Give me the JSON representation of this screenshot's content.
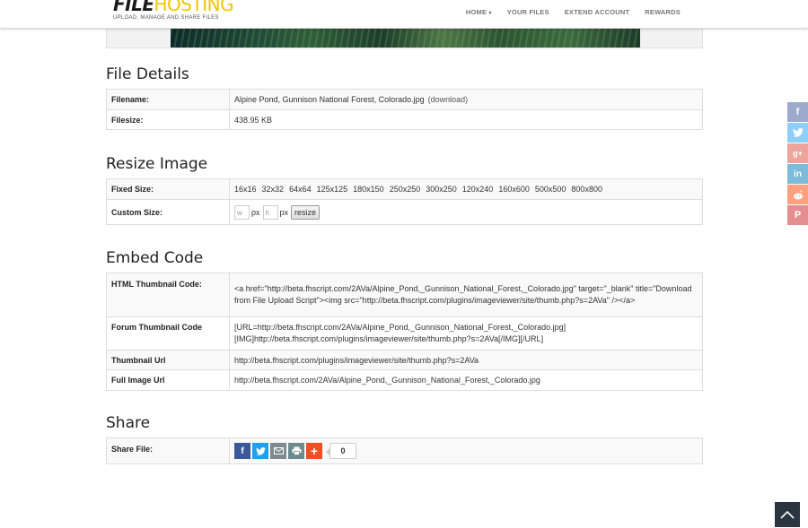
{
  "logo": {
    "file": "FILE",
    "hosting": "HOSTING",
    "tagline": "UPLOAD, MANAGE AND SHARE FILES"
  },
  "nav": {
    "home": "HOME",
    "your_files": "YOUR FILES",
    "extend": "EXTEND ACCOUNT",
    "rewards": "REWARDS"
  },
  "file_details": {
    "title": "File Details",
    "filename_label": "Filename:",
    "filename": "Alpine Pond, Gunnison National Forest, Colorado.jpg",
    "download": "(download)",
    "filesize_label": "Filesize:",
    "filesize": "438.95 KB"
  },
  "resize": {
    "title": "Resize Image",
    "fixed_label": "Fixed Size:",
    "sizes": [
      "16x16",
      "32x32",
      "64x64",
      "125x125",
      "180x150",
      "250x250",
      "300x250",
      "120x240",
      "160x600",
      "500x500",
      "800x800"
    ],
    "custom_label": "Custom Size:",
    "w_placeholder": "w",
    "h_placeholder": "h",
    "px": "px",
    "button": "resize"
  },
  "embed": {
    "title": "Embed Code",
    "rows": [
      {
        "label": "HTML Thumbnail Code:",
        "value": "<a href=\"http://beta.fhscript.com/2AVa/Alpine_Pond,_Gunnison_National_Forest,_Colorado.jpg\" target=\"_blank\" title=\"Download from File Upload Script\"><img src=\"http://beta.fhscript.com/plugins/imageviewer/site/thumb.php?s=2AVa\" /></a>"
      },
      {
        "label": "Forum Thumbnail Code",
        "value": "[URL=http://beta.fhscript.com/2AVa/Alpine_Pond,_Gunnison_National_Forest,_Colorado.jpg][IMG]http://beta.fhscript.com/plugins/imageviewer/site/thumb.php?s=2AVa[/IMG][/URL]"
      },
      {
        "label": "Thumbnail Url",
        "value": "http://beta.fhscript.com/plugins/imageviewer/site/thumb.php?s=2AVa"
      },
      {
        "label": "Full Image Url",
        "value": "http://beta.fhscript.com/2AVa/Alpine_Pond,_Gunnison_National_Forest,_Colorado.jpg"
      }
    ]
  },
  "share": {
    "title": "Share",
    "label": "Share File:",
    "count": "0",
    "colors": {
      "facebook": "#3b5998",
      "twitter": "#1da1f2",
      "email": "#7d8a8f",
      "print": "#6d8a8c",
      "more": "#f04e23"
    }
  },
  "side_social": {
    "colors": {
      "facebook": "#3b5998",
      "twitter": "#1da1f2",
      "google": "#dd4b39",
      "linkedin": "#0077b5",
      "reddit": "#ff4500",
      "pinterest": "#cb2027"
    }
  }
}
